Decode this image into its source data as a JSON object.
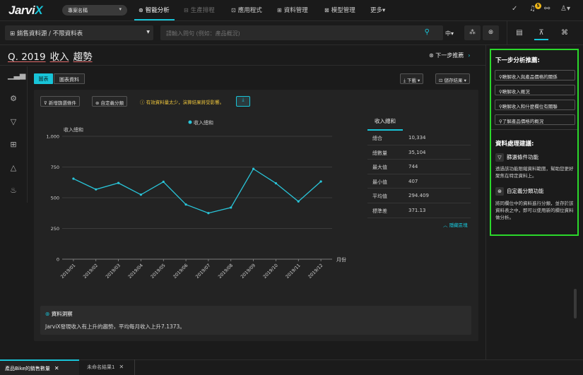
{
  "app": {
    "logo_main": "Jarvi",
    "logo_accent": "X",
    "project": "專案名稱"
  },
  "nav": [
    {
      "icon": "⊛",
      "label": "智能分析",
      "state": "active"
    },
    {
      "icon": "⊟",
      "label": "生產排程",
      "state": "disabled"
    },
    {
      "icon": "⊡",
      "label": "應用程式",
      "state": "normal"
    },
    {
      "icon": "⊞",
      "label": "資料管理",
      "state": "normal"
    },
    {
      "icon": "⊠",
      "label": "模型管理",
      "state": "normal"
    },
    {
      "icon": "",
      "label": "更多▾",
      "state": "normal"
    }
  ],
  "notifications": {
    "count": "5"
  },
  "datasource": {
    "label": "⊞ 銷售資料源 / 不限資料表"
  },
  "query": {
    "placeholder": "請輸入問句 (例如：產品概況)",
    "lang": "中▾"
  },
  "question": {
    "year": "Q. 2019",
    "measure": "收入",
    "type": "趨勢"
  },
  "next_recommend": "下一步推薦",
  "tabs": {
    "chart": "圖表",
    "chart_data": "圖表資料"
  },
  "toolbar": {
    "download": "⤓ 下載 ▾",
    "save": "⊡ 儲存結果 ▾",
    "add_filter": "新增篩選條件",
    "custom_group": "自定義分類",
    "warning": "ⓘ 有效資料量太少，演算結果將受影響。"
  },
  "chart_data": {
    "type": "line",
    "title": "",
    "legend": "收入總和",
    "legend_position": "top",
    "ylabel": "收入總和",
    "xlabel": "月份",
    "ylim": [
      0,
      1000
    ],
    "yticks": [
      "0",
      "250",
      "500",
      "750",
      "1,000"
    ],
    "grid": true,
    "color": "#29c5d9",
    "categories": [
      "2019/01",
      "2019/02",
      "2019/03",
      "2019/04",
      "2019/05",
      "2019/06",
      "2019/07",
      "2019/08",
      "2019/09",
      "2019/10",
      "2019/11",
      "2019/12"
    ],
    "values": [
      655,
      568,
      620,
      525,
      630,
      445,
      375,
      420,
      735,
      618,
      470,
      632
    ]
  },
  "stats": {
    "header": "收入總和",
    "rows": [
      {
        "k": "總合",
        "v": "10,334"
      },
      {
        "k": "總數量",
        "v": "35,104"
      },
      {
        "k": "最大值",
        "v": "744"
      },
      {
        "k": "最小值",
        "v": "407"
      },
      {
        "k": "平均值",
        "v": "294.409"
      },
      {
        "k": "標準差",
        "v": "371.13"
      }
    ],
    "hide": "︿ 隱藏區塊"
  },
  "insight": {
    "title": "資料洞察",
    "body": "JarviX發現收入有上升的趨勢，平均每月收入上升7.1373。"
  },
  "right_panel": {
    "title": "下一步分析推薦:",
    "suggestions": [
      "瞭解收入與產品價格的關係",
      "瞭解收入概況",
      "瞭解收入和什麼欄位有關聯",
      "了解產品價格的概況"
    ],
    "subtitle": "資料處理建議:",
    "tips": [
      {
        "title": "篩選條件功能",
        "body": "透過該功能限縮資料範圍，幫助您更好聚焦在特定資料上。"
      },
      {
        "title": "自定義分類功能",
        "body": "將同欄位中的資料進行分類，並存於該資料表之中，即可以使用新的欄位資料做分析。"
      }
    ]
  },
  "bottom_tabs": [
    {
      "label": "產品Bike的銷售數量"
    },
    {
      "label": "未命名結果1"
    }
  ]
}
